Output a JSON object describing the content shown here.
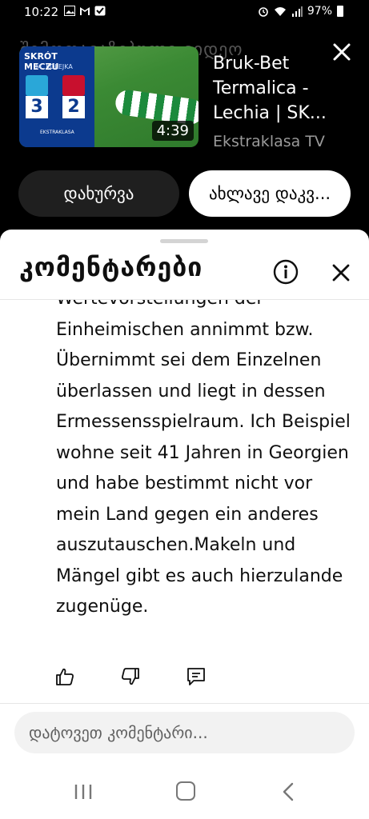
{
  "status_bar": {
    "time": "10:22",
    "battery": "97%"
  },
  "player": {
    "faded_title": "შემოთავაზებული ვიდეო",
    "video_title": "Bruk-Bet Termalica - Lechia | SK...",
    "channel": "Ekstraklasa TV",
    "duration": "4:39",
    "thumbnail": {
      "kicker": "SKRÓT MECZU",
      "round": "34. KOLEJKA",
      "score_home": "3",
      "score_away": "2",
      "league": "EKSTRAKLASA"
    },
    "dismiss_label": "დახურვა",
    "play_now_label": "ახლავე დაკვ..."
  },
  "comments": {
    "title": "კომენტარები",
    "body": "Wertevorstellungen der Einheimischen annimmt bzw. Übernimmt sei dem Einzelnen überlassen und liegt in dessen Ermessensspielraum. Ich Beispiel wohne seit 41 Jahren in Georgien und habe bestimmt nicht vor mein Land gegen ein anderes auszutauschen.Makeln und Mängel gibt es auch hierzulande zugenüge.",
    "input_placeholder": "დატოვეთ კომენტარი..."
  },
  "colors": {
    "sheet_bg": "#ffffff",
    "header_bg": "#000000",
    "thumb_panel": "#0c3a8e"
  }
}
